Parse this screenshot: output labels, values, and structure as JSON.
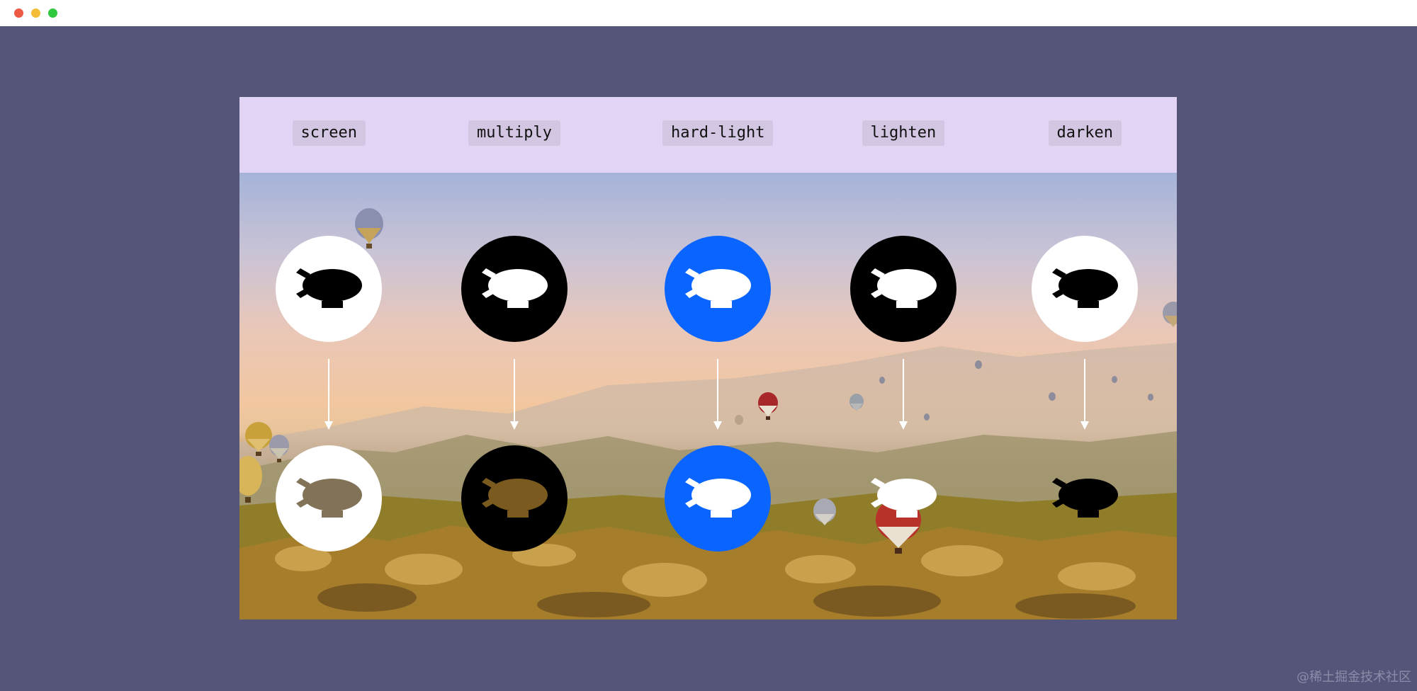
{
  "window": {
    "controls": [
      "close",
      "minimize",
      "maximize"
    ]
  },
  "blend_modes": [
    {
      "label": "screen",
      "top_fill": "#ffffff",
      "top_icon": "#000000"
    },
    {
      "label": "multiply",
      "top_fill": "#000000",
      "top_icon": "#ffffff"
    },
    {
      "label": "hard-light",
      "top_fill": "#0a64ff",
      "top_icon": "#ffffff"
    },
    {
      "label": "lighten",
      "top_fill": "#000000",
      "top_icon": "#ffffff"
    },
    {
      "label": "darken",
      "top_fill": "#ffffff",
      "top_icon": "#000000"
    }
  ],
  "colors": {
    "page_background": "#55557a",
    "header_band": "#e2d4f4",
    "chip": "#d2c6e3",
    "blue": "#0a64ff"
  },
  "icons": {
    "badge_icon": "blimp-icon",
    "connector": "arrow-down-icon"
  },
  "watermark": "@稀土掘金技术社区"
}
